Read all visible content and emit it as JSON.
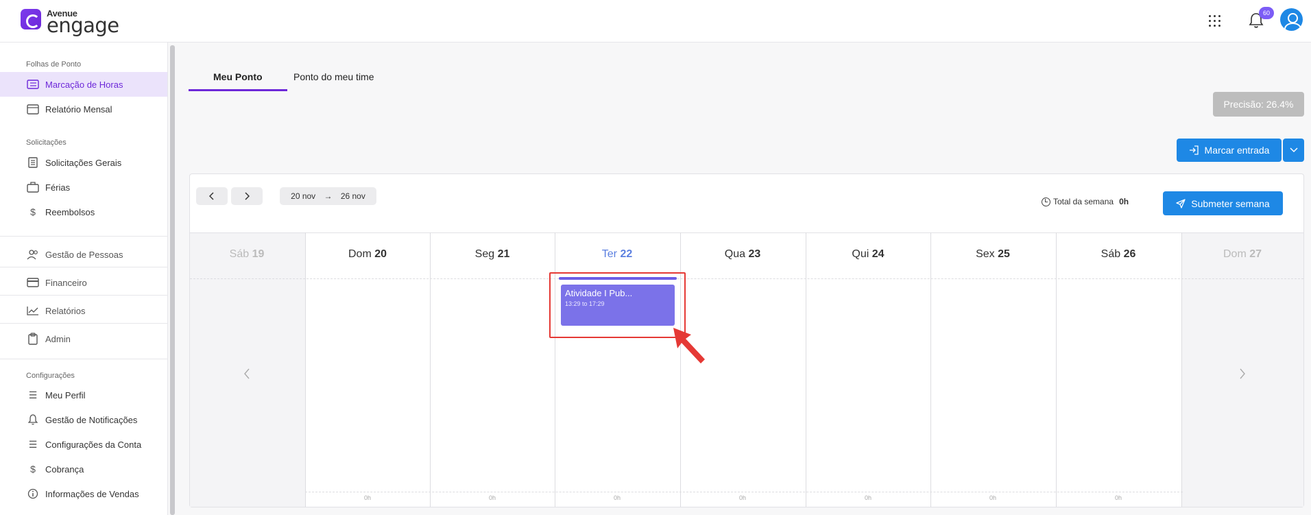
{
  "header": {
    "brand_top": "Avenue",
    "brand_main": "engage",
    "notifications_count": "60"
  },
  "sidebar": {
    "sections": {
      "folhas": "Folhas de Ponto",
      "solicitacoes": "Solicitações",
      "configuracoes": "Configurações"
    },
    "items": [
      {
        "label": "Marcação de Horas",
        "icon": "time-sheet-icon"
      },
      {
        "label": "Relatório Mensal",
        "icon": "calendar-icon"
      },
      {
        "label": "Solicitações Gerais",
        "icon": "document-icon"
      },
      {
        "label": "Férias",
        "icon": "luggage-icon"
      },
      {
        "label": "Reembolsos",
        "icon": "dollar-icon"
      },
      {
        "label": "Gestão de Pessoas",
        "icon": "people-icon"
      },
      {
        "label": "Financeiro",
        "icon": "credit-card-icon"
      },
      {
        "label": "Relatórios",
        "icon": "chart-line-icon"
      },
      {
        "label": "Admin",
        "icon": "clipboard-icon"
      },
      {
        "label": "Meu Perfil",
        "icon": "list-icon"
      },
      {
        "label": "Gestão de Notificações",
        "icon": "bell-icon"
      },
      {
        "label": "Configurações da Conta",
        "icon": "list-icon"
      },
      {
        "label": "Cobrança",
        "icon": "dollar-icon"
      },
      {
        "label": "Informações de Vendas",
        "icon": "info-icon"
      }
    ]
  },
  "tabs": [
    {
      "label": "Meu Ponto",
      "active": true
    },
    {
      "label": "Ponto do meu time",
      "active": false
    }
  ],
  "precision": "Precisão: 26.4%",
  "clock_in_button": "Marcar entrada",
  "week": {
    "start": "20 nov",
    "end": "26 nov",
    "total_label": "Total da semana",
    "total_value": "0h",
    "submit_label": "Submeter semana"
  },
  "days": [
    {
      "name": "Sáb",
      "num": "19"
    },
    {
      "name": "Dom",
      "num": "20",
      "hours": "0h"
    },
    {
      "name": "Seg",
      "num": "21",
      "hours": "0h"
    },
    {
      "name": "Ter",
      "num": "22",
      "hours": "0h"
    },
    {
      "name": "Qua",
      "num": "23",
      "hours": "0h"
    },
    {
      "name": "Qui",
      "num": "24",
      "hours": "0h"
    },
    {
      "name": "Sex",
      "num": "25",
      "hours": "0h"
    },
    {
      "name": "Sáb",
      "num": "26",
      "hours": "0h"
    },
    {
      "name": "Dom",
      "num": "27"
    }
  ],
  "event": {
    "title": "Atividade I Pub...",
    "time": "13:29 to 17:29"
  },
  "colors": {
    "accent_purple": "#6d28d9",
    "primary_blue": "#1e88e5",
    "event_purple": "#7b72e9",
    "highlight_red": "#e53935"
  }
}
